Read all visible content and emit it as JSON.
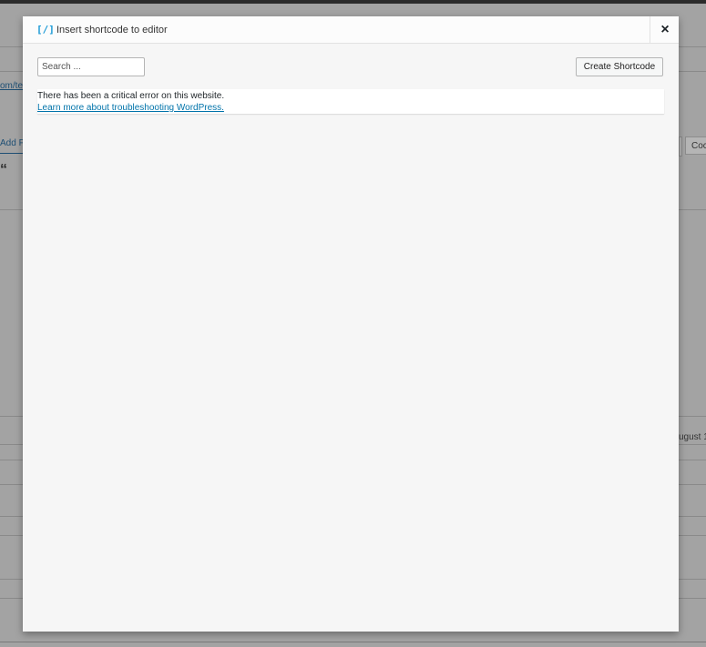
{
  "modal": {
    "icon_glyph": "[/]",
    "title": "Insert shortcode to editor",
    "close_glyph": "×",
    "search": {
      "placeholder": "Search ..."
    },
    "create_button_label": "Create Shortcode",
    "error": {
      "message": "There has been a critical error on this website.",
      "link_text": "Learn more about troubleshooting WordPress."
    }
  },
  "background": {
    "link_fragment": "om/te",
    "add_fragment": "Add F",
    "quote_glyph": "“",
    "code_tab_fragment": "Coc",
    "date_fragment": "ugust 15"
  },
  "colors": {
    "overlay": "#a3a3a3",
    "modal_bg": "#f6f6f6",
    "accent": "#1a9ad6",
    "link": "#0073aa"
  }
}
